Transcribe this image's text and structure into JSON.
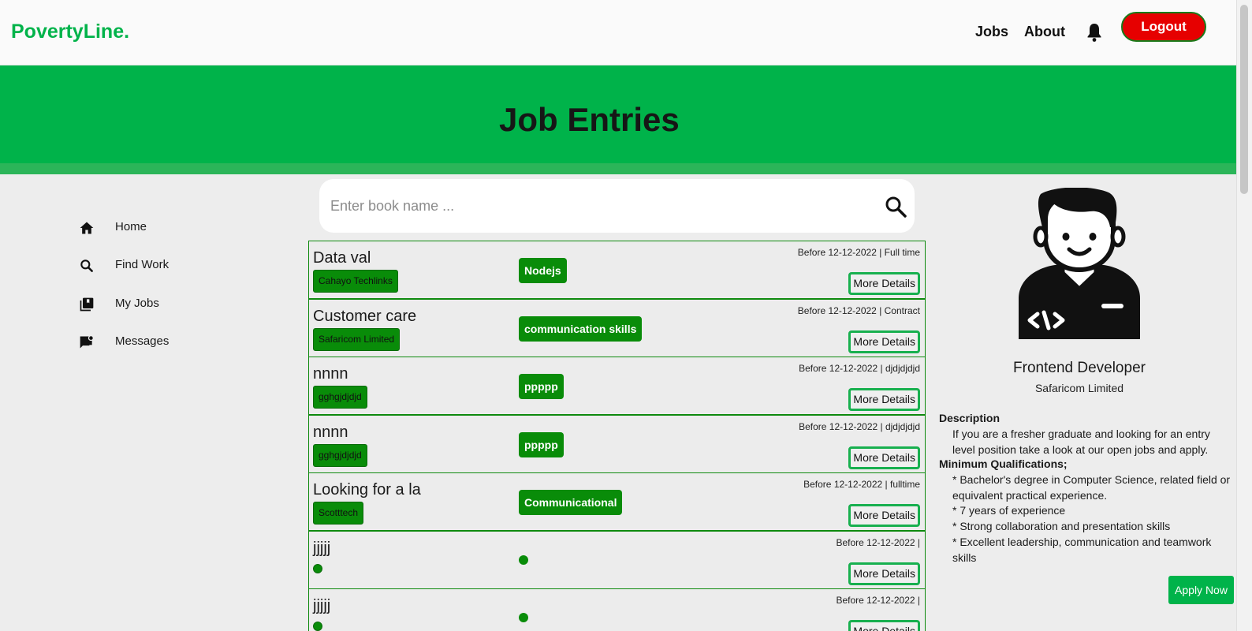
{
  "navbar": {
    "brand": "PovertyLine.",
    "links": [
      "Jobs",
      "About"
    ],
    "logout_label": "Logout",
    "bell_icon": "bell-icon"
  },
  "hero": {
    "title": "Job Entries"
  },
  "sidebar": {
    "items": [
      {
        "label": "Home",
        "icon": "home-icon"
      },
      {
        "label": "Find Work",
        "icon": "search-icon"
      },
      {
        "label": "My Jobs",
        "icon": "library-icon"
      },
      {
        "label": "Messages",
        "icon": "message-icon"
      }
    ]
  },
  "search": {
    "placeholder": "Enter book name ...",
    "value": ""
  },
  "jobs": [
    {
      "title": "Data val",
      "company": "Cahayo Techlinks",
      "skill": "Nodejs",
      "meta": "Before 12-12-2022 | Full time",
      "button": "More Details"
    },
    {
      "title": "Customer care",
      "company": "Safaricom Limited",
      "skill": "communication skills",
      "meta": "Before 12-12-2022 | Contract",
      "button": "More Details"
    },
    {
      "title": "nnnn",
      "company": "gghgjdjdjd",
      "skill": "ppppp",
      "meta": "Before 12-12-2022 | djdjdjdjd",
      "button": "More Details"
    },
    {
      "title": "nnnn",
      "company": "gghgjdjdjd",
      "skill": "ppppp",
      "meta": "Before 12-12-2022 | djdjdjdjd",
      "button": "More Details"
    },
    {
      "title": "Looking for a la",
      "company": "Scotttech",
      "skill": "Communicational",
      "meta": "Before 12-12-2022 | fulltime",
      "button": "More Details"
    },
    {
      "title": "jjjjj",
      "company": "",
      "skill": "",
      "meta": "Before 12-12-2022 |",
      "button": "More Details"
    },
    {
      "title": "jjjjj",
      "company": "",
      "skill": "",
      "meta": "Before 12-12-2022 |",
      "button": "More Details"
    }
  ],
  "profile": {
    "role": "Frontend Developer",
    "company": "Safaricom Limited",
    "description_heading": "Description",
    "description": "If you are a fresher graduate and looking for an entry level position take a look at our open jobs and apply.",
    "qualifications_heading": "Minimum Qualifications;",
    "qualifications": [
      "* Bachelor's degree in Computer Science, related field or equivalent practical experience.",
      "* 7 years of experience",
      "* Strong collaboration and presentation skills",
      "* Excellent leadership, communication and teamwork skills"
    ],
    "apply_label": "Apply Now"
  },
  "colors": {
    "brand_green": "#00b34a",
    "tag_green": "#098c09",
    "logout_red": "#e60000"
  }
}
